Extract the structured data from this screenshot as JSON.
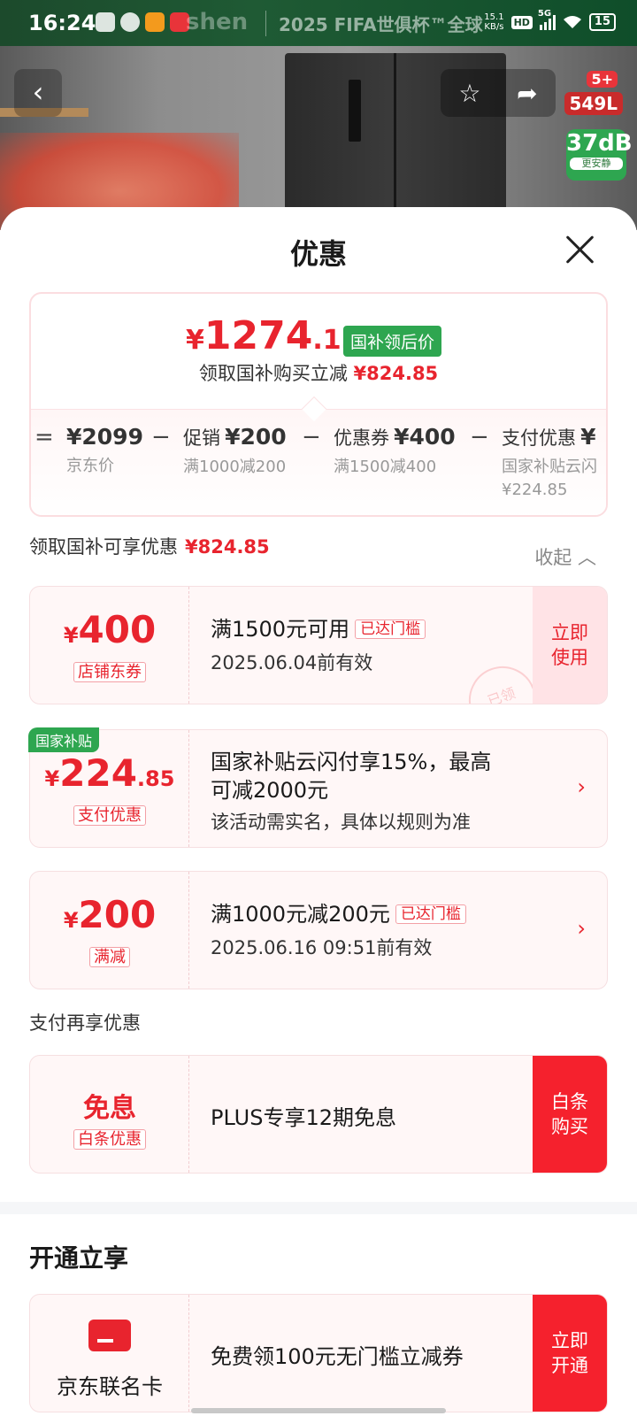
{
  "status_bar": {
    "time": "16:24",
    "ghost_text": "shen",
    "banner": "2025 FIFA世俱杯™全球",
    "net_speed_value": "15.1",
    "net_speed_unit": "KB/s",
    "hd": "HD",
    "network": "5G",
    "battery": "15",
    "icons": [
      "signal-icon",
      "wifi-icon",
      "battery-icon"
    ]
  },
  "product_bg": {
    "badge_count": "5+",
    "capacity": "549L",
    "noise": "37dB",
    "noise_note": "更安静"
  },
  "sheet": {
    "title": "优惠",
    "summary": {
      "final_price_symbol": "¥",
      "final_price_int": "1274",
      "final_price_dec": ".15",
      "final_tag": "国补领后价",
      "subsidy_text": "领取国补购买立减",
      "subsidy_amount": "¥824.85",
      "breakdown": [
        {
          "op": "=",
          "label": "",
          "amount": "¥2099",
          "sub1": "京东价",
          "sub2": ""
        },
        {
          "op": "−",
          "label": "促销",
          "amount": "¥200",
          "sub1": "满1000减200",
          "sub2": ""
        },
        {
          "op": "−",
          "label": "优惠券",
          "amount": "¥400",
          "sub1": "满1500减400",
          "sub2": ""
        },
        {
          "op": "−",
          "label": "支付优惠",
          "amount": "¥",
          "sub1": "国家补贴云闪",
          "sub2": "¥224.85"
        }
      ]
    },
    "national_label": "领取国补可享优惠",
    "national_amount": "¥824.85",
    "collapse_label": "收起",
    "coupons": [
      {
        "flag": "",
        "symbol": "¥",
        "amount": "400",
        "decimal": "",
        "kind": "店铺东券",
        "title": "满1500元可用",
        "met": "已达门槛",
        "desc": "2025.06.04前有效",
        "action": "立即使用",
        "stamp": "已领"
      },
      {
        "flag": "国家补贴",
        "symbol": "¥",
        "amount": "224",
        "decimal": ".85",
        "kind": "支付优惠",
        "title": "国家补贴云闪付享15%，最高",
        "title2": "可减2000元",
        "desc": "该活动需实名，具体以规则为准"
      },
      {
        "flag": "",
        "symbol": "¥",
        "amount": "200",
        "decimal": "",
        "kind": "满减",
        "title": "满1000元减200元",
        "met": "已达门槛",
        "desc": "2025.06.16 09:51前有效"
      }
    ],
    "pay_section_label": "支付再享优惠",
    "pay_coupon": {
      "amount": "免息",
      "kind": "白条优惠",
      "title": "PLUS专享12期免息",
      "action": "白条购买"
    },
    "open_section_title": "开通立享",
    "open_coupon": {
      "kind": "京东联名卡",
      "title": "免费领100元无门槛立减券",
      "action": "立即开通"
    }
  }
}
